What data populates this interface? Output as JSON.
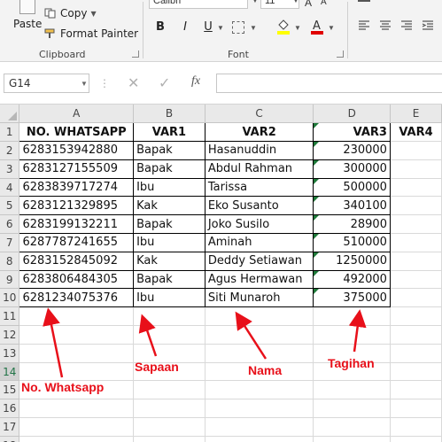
{
  "ribbon": {
    "clipboard": {
      "paste_label": "Paste",
      "copy_label": "Copy",
      "format_painter_label": "Format Painter",
      "group_label": "Clipboard"
    },
    "font": {
      "font_name": "Calibri",
      "font_size": "11",
      "bold_label": "B",
      "italic_label": "I",
      "underline_label": "U",
      "group_label": "Font"
    }
  },
  "formula_bar": {
    "name_box": "G14",
    "fx_label": "fx",
    "cancel_glyph": "✕",
    "enter_glyph": "✓",
    "formula_value": ""
  },
  "sheet": {
    "columns": [
      "A",
      "B",
      "C",
      "D",
      "E"
    ],
    "rows": [
      {
        "num": "1",
        "cells": [
          "NO. WHATSAPP",
          "VAR1",
          "VAR2",
          "VAR3",
          "VAR4"
        ]
      },
      {
        "num": "2",
        "cells": [
          "6283153942880",
          "Bapak",
          "Hasanuddin",
          "230000",
          ""
        ]
      },
      {
        "num": "3",
        "cells": [
          "6283127155509",
          "Bapak",
          "Abdul Rahman",
          "300000",
          ""
        ]
      },
      {
        "num": "4",
        "cells": [
          "6283839717274",
          "Ibu",
          "Tarissa",
          "500000",
          ""
        ]
      },
      {
        "num": "5",
        "cells": [
          "6283121329895",
          "Kak",
          "Eko Susanto",
          "340100",
          ""
        ]
      },
      {
        "num": "6",
        "cells": [
          "6283199132211",
          "Bapak",
          "Joko Susilo",
          "28900",
          ""
        ]
      },
      {
        "num": "7",
        "cells": [
          "6287787241655",
          "Ibu",
          "Aminah",
          "510000",
          ""
        ]
      },
      {
        "num": "8",
        "cells": [
          "6283152845092",
          "Kak",
          "Deddy Setiawan",
          "1250000",
          ""
        ]
      },
      {
        "num": "9",
        "cells": [
          "6283806484305",
          "Bapak",
          "Agus Hermawan",
          "492000",
          ""
        ]
      },
      {
        "num": "10",
        "cells": [
          "6281234075376",
          "Ibu",
          "Siti Munaroh",
          "375000",
          ""
        ]
      },
      {
        "num": "11",
        "cells": [
          "",
          "",
          "",
          "",
          ""
        ]
      },
      {
        "num": "12",
        "cells": [
          "",
          "",
          "",
          "",
          ""
        ]
      },
      {
        "num": "13",
        "cells": [
          "",
          "",
          "",
          "",
          ""
        ]
      },
      {
        "num": "14",
        "cells": [
          "",
          "",
          "",
          "",
          ""
        ]
      },
      {
        "num": "15",
        "cells": [
          "",
          "",
          "",
          "",
          ""
        ]
      },
      {
        "num": "16",
        "cells": [
          "",
          "",
          "",
          "",
          ""
        ]
      },
      {
        "num": "17",
        "cells": [
          "",
          "",
          "",
          "",
          ""
        ]
      },
      {
        "num": "18",
        "cells": [
          "",
          "",
          "",
          "",
          ""
        ]
      }
    ],
    "active_row": "14"
  },
  "annotations": {
    "no_whatsapp": "No. Whatsapp",
    "sapaan": "Sapaan",
    "nama": "Nama",
    "tagihan": "Tagihan",
    "color": "#e8101a"
  }
}
